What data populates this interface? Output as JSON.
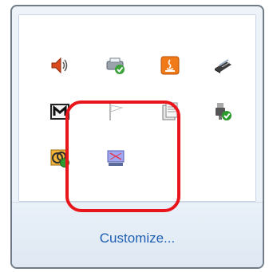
{
  "flyout": {
    "icons": [
      {
        "name": "volume-icon",
        "label": ""
      },
      {
        "name": "printer-check-icon",
        "label": ""
      },
      {
        "name": "java-icon",
        "label": ""
      },
      {
        "name": "scanner-icon",
        "label": ""
      },
      {
        "name": "m-app-icon",
        "label": ""
      },
      {
        "name": "flag-icon",
        "label": ""
      },
      {
        "name": "clipboard-doc-icon",
        "label": ""
      },
      {
        "name": "usb-check-icon",
        "label": ""
      },
      {
        "name": "network-sync-icon",
        "label": ""
      },
      {
        "name": "monitor-icon",
        "label": ""
      }
    ],
    "customize_label": "Customize..."
  },
  "colors": {
    "link": "#1e5fb3",
    "annotation": "#e8151b",
    "border": "#6f7b87",
    "footer": "#e4ecf5"
  }
}
